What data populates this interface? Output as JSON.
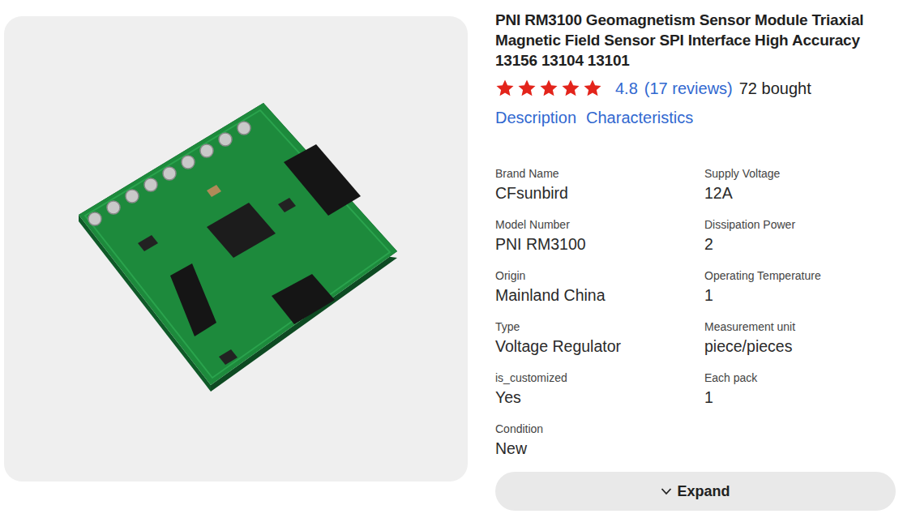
{
  "product": {
    "title": "PNI RM3100 Geomagnetism Sensor Module Triaxial Magnetic Field Sensor SPI Interface High Accuracy 13156 13104 13101",
    "rating": {
      "stars": 5,
      "score": "4.8",
      "reviews": "(17 reviews)",
      "bought": "72 bought"
    }
  },
  "tabs": [
    {
      "label": "Description"
    },
    {
      "label": "Characteristics"
    }
  ],
  "specs": [
    {
      "label": "Brand Name",
      "value": "CFsunbird"
    },
    {
      "label": "Supply Voltage",
      "value": "12A"
    },
    {
      "label": "Model Number",
      "value": "PNI RM3100"
    },
    {
      "label": "Dissipation Power",
      "value": "2"
    },
    {
      "label": "Origin",
      "value": "Mainland China"
    },
    {
      "label": "Operating Temperature",
      "value": "1"
    },
    {
      "label": "Type",
      "value": "Voltage Regulator"
    },
    {
      "label": "Measurement unit",
      "value": "piece/pieces"
    },
    {
      "label": "is_customized",
      "value": "Yes"
    },
    {
      "label": "Each pack",
      "value": "1"
    },
    {
      "label": "Condition",
      "value": "New"
    }
  ],
  "expand": {
    "label": "Expand"
  }
}
